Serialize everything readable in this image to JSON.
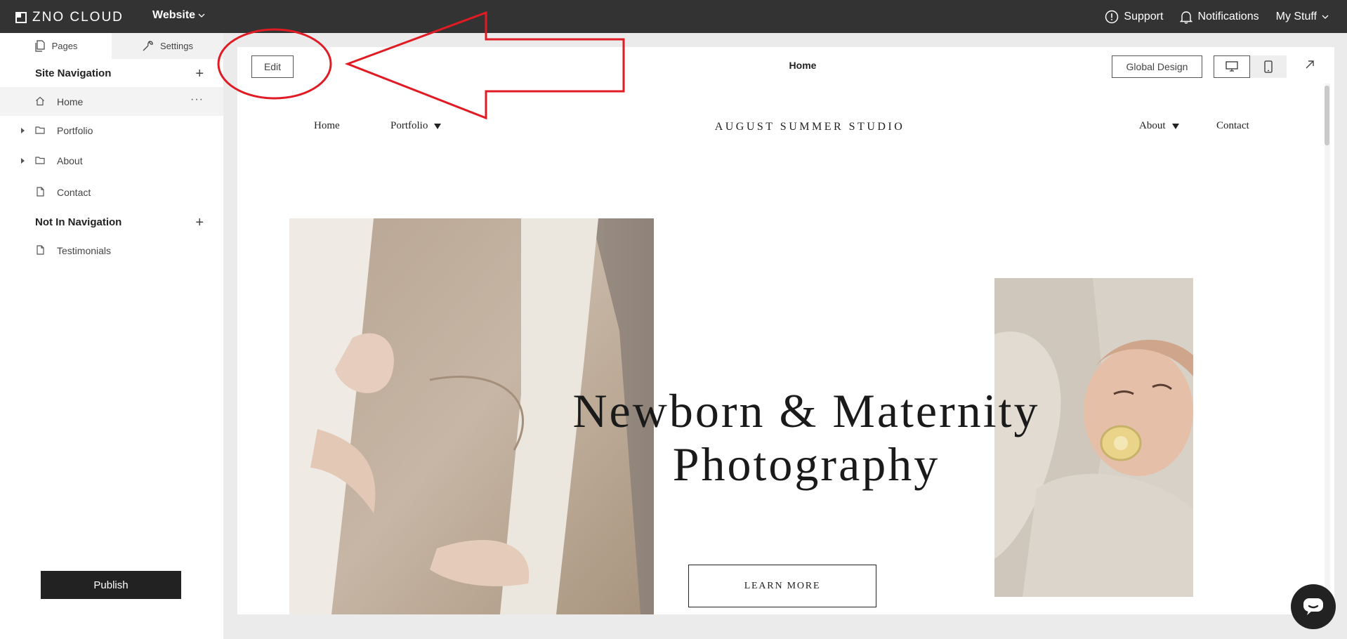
{
  "topbar": {
    "logo_text": "ZNO CLOUD",
    "website_label": "Website",
    "support_label": "Support",
    "notifications_label": "Notifications",
    "mystuff_label": "My Stuff"
  },
  "sidebar": {
    "tabs": [
      {
        "label": "Pages"
      },
      {
        "label": "Settings"
      }
    ],
    "site_navigation_label": "Site Navigation",
    "not_in_navigation_label": "Not In Navigation",
    "nav_items": [
      {
        "label": "Home",
        "icon": "home-icon"
      },
      {
        "label": "Portfolio",
        "icon": "folder-icon"
      },
      {
        "label": "About",
        "icon": "folder-icon"
      },
      {
        "label": "Contact",
        "icon": "page-icon"
      }
    ],
    "other_items": [
      {
        "label": "Testimonials",
        "icon": "page-icon"
      }
    ],
    "publish_label": "Publish"
  },
  "editor": {
    "edit_label": "Edit",
    "page_label": "Home",
    "global_design_label": "Global Design"
  },
  "site": {
    "nav": {
      "home": "Home",
      "portfolio": "Portfolio",
      "about": "About",
      "contact": "Contact"
    },
    "brand": "AUGUST SUMMER STUDIO",
    "hero_line1": "Newborn & Maternity",
    "hero_line2": "Photography",
    "cta_label": "LEARN MORE"
  },
  "colors": {
    "topbar_bg": "#333333",
    "annotation_red": "#e01b24",
    "publish_bg": "#222222"
  }
}
